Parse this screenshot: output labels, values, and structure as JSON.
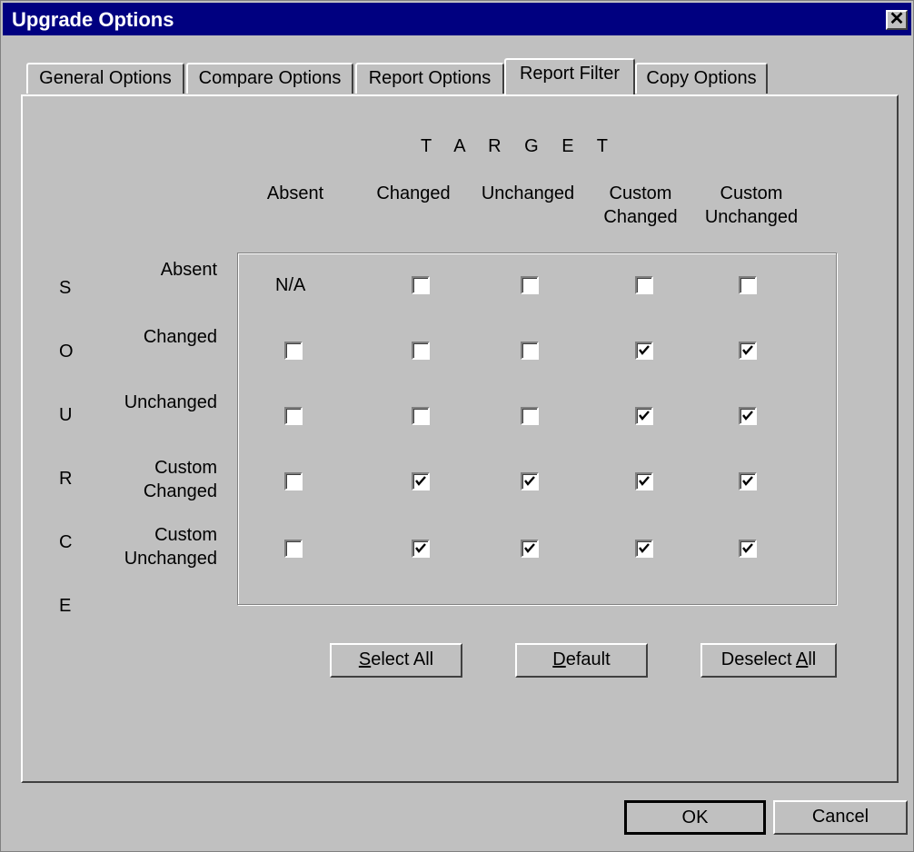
{
  "window": {
    "title": "Upgrade Options",
    "close_glyph": "✕"
  },
  "tabs": [
    {
      "label": "General Options",
      "active": false
    },
    {
      "label": "Compare Options",
      "active": false
    },
    {
      "label": "Report Options",
      "active": false
    },
    {
      "label": "Report Filter",
      "active": true
    },
    {
      "label": "Copy Options",
      "active": false
    }
  ],
  "filter": {
    "target_heading": "T A R G E T",
    "source_heading": "S O U R C E",
    "columns": [
      {
        "line1": "",
        "line2": "Absent"
      },
      {
        "line1": "",
        "line2": "Changed"
      },
      {
        "line1": "",
        "line2": "Unchanged"
      },
      {
        "line1": "Custom",
        "line2": "Changed"
      },
      {
        "line1": "Custom",
        "line2": "Unchanged"
      }
    ],
    "rows": [
      {
        "line1": "",
        "line2": "Absent",
        "cells": [
          "N/A",
          false,
          false,
          false,
          false
        ]
      },
      {
        "line1": "",
        "line2": "Changed",
        "cells": [
          false,
          false,
          false,
          true,
          true
        ]
      },
      {
        "line1": "",
        "line2": "Unchanged",
        "cells": [
          false,
          false,
          false,
          true,
          true
        ]
      },
      {
        "line1": "Custom",
        "line2": "Changed",
        "cells": [
          false,
          true,
          true,
          true,
          true
        ]
      },
      {
        "line1": "Custom",
        "line2": "Unchanged",
        "cells": [
          false,
          true,
          true,
          true,
          true
        ]
      }
    ],
    "na_label": "N/A"
  },
  "buttons": {
    "select_all": {
      "mnemonic": "S",
      "rest": "elect All"
    },
    "default": {
      "mnemonic": "D",
      "rest": "efault"
    },
    "deselect_all": {
      "prefix": "Deselect ",
      "mnemonic": "A",
      "rest": "ll"
    },
    "ok": "OK",
    "cancel": "Cancel"
  }
}
